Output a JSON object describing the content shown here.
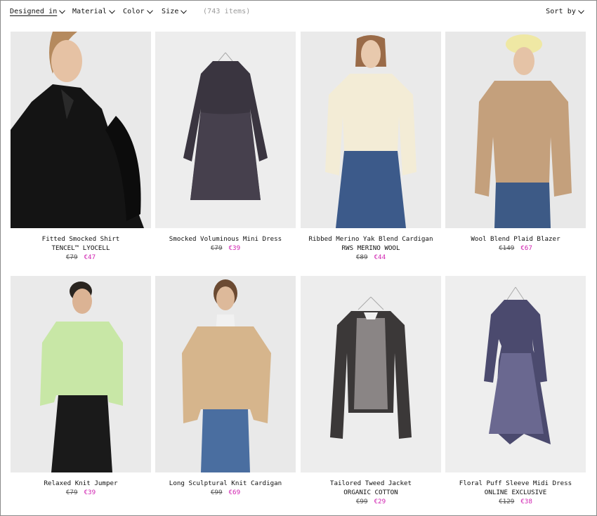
{
  "filters": {
    "designed_in": "Designed in",
    "material": "Material",
    "color": "Color",
    "size": "Size",
    "count": "(743 items)",
    "sort_by": "Sort by"
  },
  "products": [
    {
      "name": "Fitted Smocked Shirt",
      "sub": "TENCEL™ LYOCELL",
      "old_price": "€79",
      "new_price": "€47"
    },
    {
      "name": "Smocked Voluminous Mini Dress",
      "sub": "",
      "old_price": "€79",
      "new_price": "€39"
    },
    {
      "name": "Ribbed Merino Yak Blend Cardigan",
      "sub": "RWS MERINO WOOL",
      "old_price": "€89",
      "new_price": "€44"
    },
    {
      "name": "Wool Blend Plaid Blazer",
      "sub": "",
      "old_price": "€149",
      "new_price": "€67"
    },
    {
      "name": "Relaxed Knit Jumper",
      "sub": "",
      "old_price": "€79",
      "new_price": "€39"
    },
    {
      "name": "Long Sculptural Knit Cardigan",
      "sub": "",
      "old_price": "€99",
      "new_price": "€69"
    },
    {
      "name": "Tailored Tweed Jacket",
      "sub": "ORGANIC COTTON",
      "old_price": "€99",
      "new_price": "€29"
    },
    {
      "name": "Floral Puff Sleeve Midi Dress",
      "sub": "ONLINE EXCLUSIVE",
      "old_price": "€129",
      "new_price": "€38"
    }
  ],
  "colors": {
    "sale": "#d020b0",
    "count": "#9a9a9a",
    "image_bg": "#ececec"
  }
}
